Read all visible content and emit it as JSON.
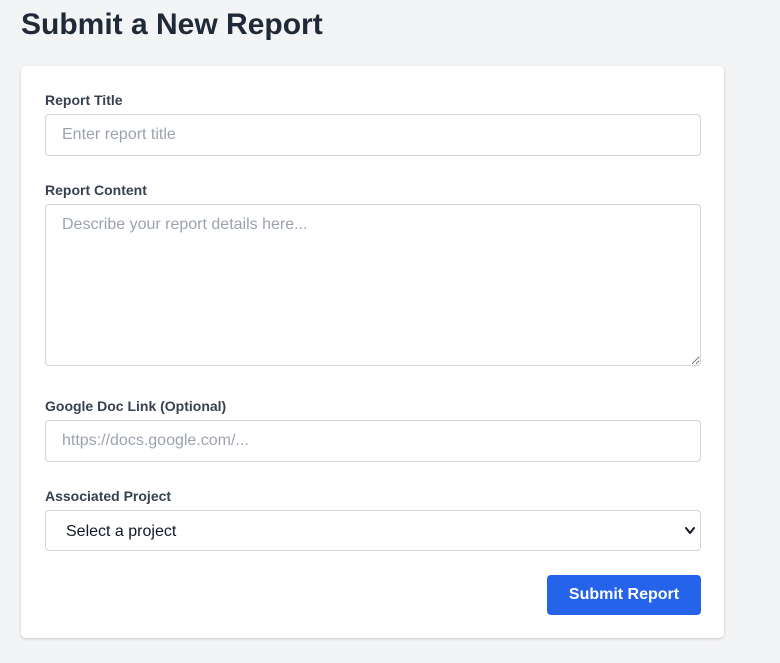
{
  "page": {
    "title": "Submit a New Report"
  },
  "form": {
    "report_title": {
      "label": "Report Title",
      "placeholder": "Enter report title",
      "value": ""
    },
    "report_content": {
      "label": "Report Content",
      "placeholder": "Describe your report details here...",
      "value": ""
    },
    "google_doc_link": {
      "label": "Google Doc Link (Optional)",
      "placeholder": "https://docs.google.com/...",
      "value": ""
    },
    "associated_project": {
      "label": "Associated Project",
      "selected": "Select a project"
    },
    "submit_label": "Submit Report"
  },
  "colors": {
    "background": "#f3f4f6",
    "card": "#ffffff",
    "accent": "#2563eb",
    "border": "#d1d5db"
  },
  "icons": {
    "select_arrow": "chevron-down-icon"
  }
}
